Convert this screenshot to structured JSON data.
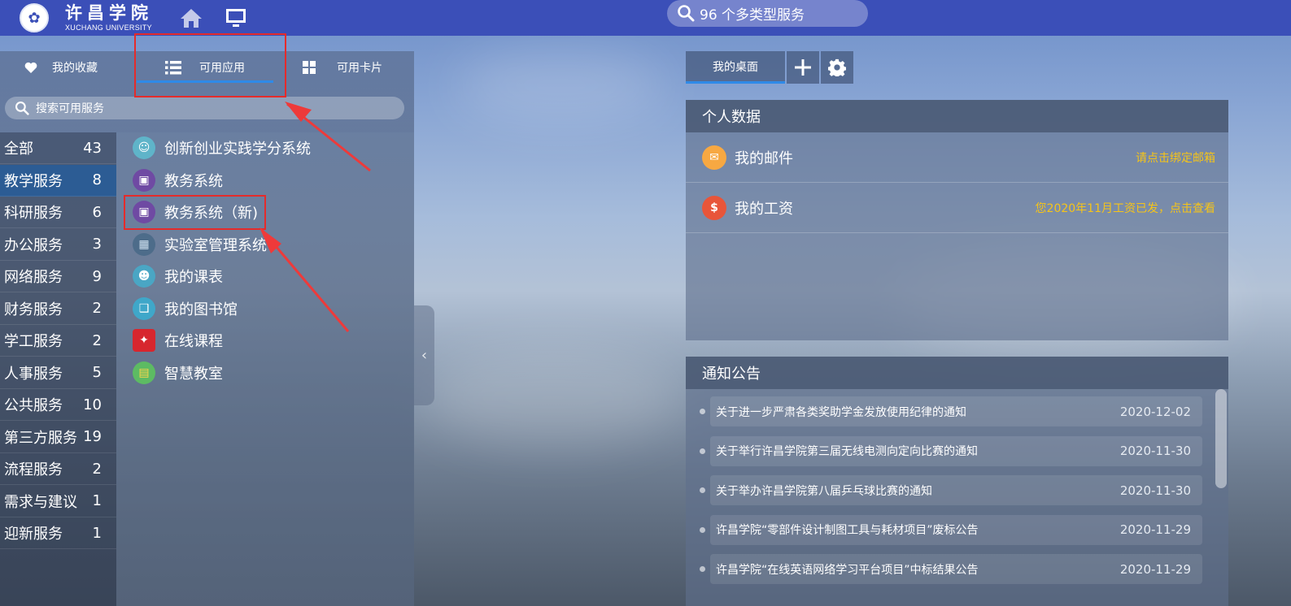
{
  "topbar": {
    "logo_cn": "许昌学院",
    "logo_en": "XUCHANG UNIVERSITY",
    "search_text": "96 个多类型服务",
    "home_icon": "home-icon",
    "desktop_icon": "desktop-icon"
  },
  "left_tabs": [
    {
      "label": "我的收藏",
      "icon": "heart-icon"
    },
    {
      "label": "可用应用",
      "icon": "list-icon",
      "active": true
    },
    {
      "label": "可用卡片",
      "icon": "grid-icon"
    }
  ],
  "left_search": {
    "placeholder": "搜索可用服务"
  },
  "categories": [
    {
      "label": "全部",
      "count": "43"
    },
    {
      "label": "教学服务",
      "count": "8",
      "active": true
    },
    {
      "label": "科研服务",
      "count": "6"
    },
    {
      "label": "办公服务",
      "count": "3"
    },
    {
      "label": "网络服务",
      "count": "9"
    },
    {
      "label": "财务服务",
      "count": "2"
    },
    {
      "label": "学工服务",
      "count": "2"
    },
    {
      "label": "人事服务",
      "count": "5"
    },
    {
      "label": "公共服务",
      "count": "10"
    },
    {
      "label": "第三方服务",
      "count": "19"
    },
    {
      "label": "流程服务",
      "count": "2"
    },
    {
      "label": "需求与建议",
      "count": "1"
    },
    {
      "label": "迎新服务",
      "count": "1"
    }
  ],
  "apps": [
    {
      "label": "创新创业实践学分系统",
      "icon": "person-icon"
    },
    {
      "label": "教务系统",
      "icon": "monitor-icon"
    },
    {
      "label": "教务系统（新)",
      "icon": "monitor-icon"
    },
    {
      "label": "实验室管理系统",
      "icon": "building-icon"
    },
    {
      "label": "我的课表",
      "icon": "teacher-icon"
    },
    {
      "label": "我的图书馆",
      "icon": "book-icon"
    },
    {
      "label": "在线课程",
      "icon": "course-icon"
    },
    {
      "label": "智慧教室",
      "icon": "classroom-icon"
    }
  ],
  "desk": {
    "tab_label": "我的桌面",
    "add_icon": "plus-icon",
    "settings_icon": "gear-icon"
  },
  "personal": {
    "title": "个人数据",
    "rows": [
      {
        "label": "我的邮件",
        "link": "请点击绑定邮箱",
        "icon": "mail-icon"
      },
      {
        "label": "我的工资",
        "link": "您2020年11月工资已发，点击查看",
        "icon": "salary-icon"
      }
    ]
  },
  "notices": {
    "title": "通知公告",
    "items": [
      {
        "text": "关于进一步严肃各类奖助学金发放使用纪律的通知",
        "date": "2020-12-02"
      },
      {
        "text": "关于举行许昌学院第三届无线电测向定向比赛的通知",
        "date": "2020-11-30"
      },
      {
        "text": "关于举办许昌学院第八届乒乓球比赛的通知",
        "date": "2020-11-30"
      },
      {
        "text": "许昌学院“零部件设计制图工具与耗材项目”废标公告",
        "date": "2020-11-29"
      },
      {
        "text": "许昌学院“在线英语网络学习平台项目”中标结果公告",
        "date": "2020-11-29"
      }
    ]
  },
  "colors": {
    "topbar": "#3b4fb8",
    "active_category": "#2c5c94",
    "accent_underline": "#2f8ae8",
    "link_yellow": "#f6c418",
    "annotation_red": "#e52b2b"
  }
}
